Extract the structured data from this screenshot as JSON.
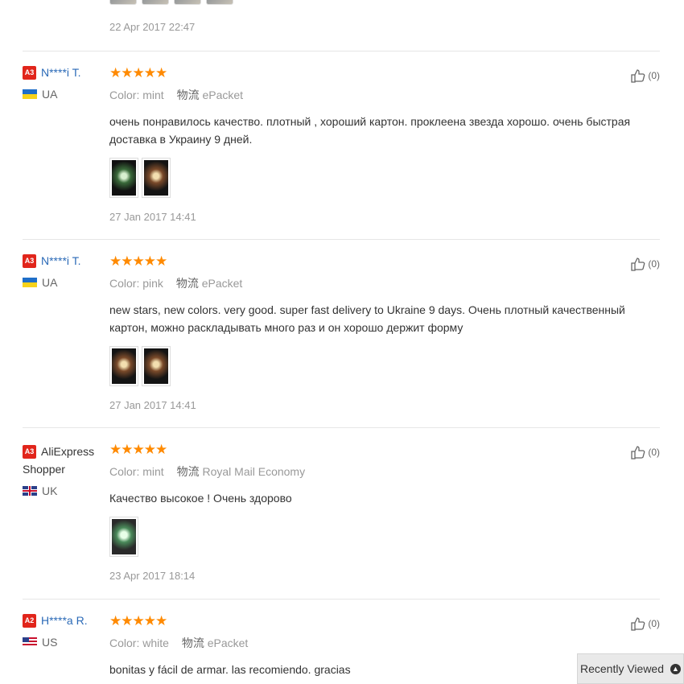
{
  "top_review": {
    "date": "22 Apr 2017 22:47"
  },
  "reviews": [
    {
      "badge": "A3",
      "username": "N****i T.",
      "country": "UA",
      "color_label": "Color:",
      "color_value": "mint",
      "shipping_label": "物流",
      "shipping_value": "ePacket",
      "text": "очень понравилось качество. плотный , хороший картон. проклеена звезда хорошо. очень быстрая доставка в Украину 9 дней.",
      "date": "27 Jan 2017 14:41",
      "likes": "(0)",
      "rating": 5
    },
    {
      "badge": "A3",
      "username": "N****i T.",
      "country": "UA",
      "color_label": "Color:",
      "color_value": "pink",
      "shipping_label": "物流",
      "shipping_value": "ePacket",
      "text": "new stars, new colors. very good. super fast delivery to Ukraine 9 days. Очень плотный качественный картон, можно раскладывать много раз и он хорошо держит форму",
      "date": "27 Jan 2017 14:41",
      "likes": "(0)",
      "rating": 5
    },
    {
      "badge": "A3",
      "username_line1": "AliExpress",
      "username_line2": "Shopper",
      "country": "UK",
      "color_label": "Color:",
      "color_value": "mint",
      "shipping_label": "物流",
      "shipping_value": "Royal Mail Economy",
      "text": "Качество высокое ! Очень здорово",
      "date": "23 Apr 2017 18:14",
      "likes": "(0)",
      "rating": 5
    },
    {
      "badge": "A2",
      "username": "H****a R.",
      "country": "US",
      "color_label": "Color:",
      "color_value": "white",
      "shipping_label": "物流",
      "shipping_value": "ePacket",
      "text": "bonitas y fácil de armar. las recomiendo. gracias",
      "likes": "(0)",
      "rating": 5
    }
  ],
  "stars_glyph": "★★★★★",
  "recently_viewed": {
    "label": "Recently Viewed"
  },
  "icons": {
    "like": "thumbs-up-icon",
    "up": "chevron-up-icon"
  },
  "colors": {
    "star": "#ff8a00",
    "username": "#2b6ab7",
    "badge": "#e1251b"
  }
}
